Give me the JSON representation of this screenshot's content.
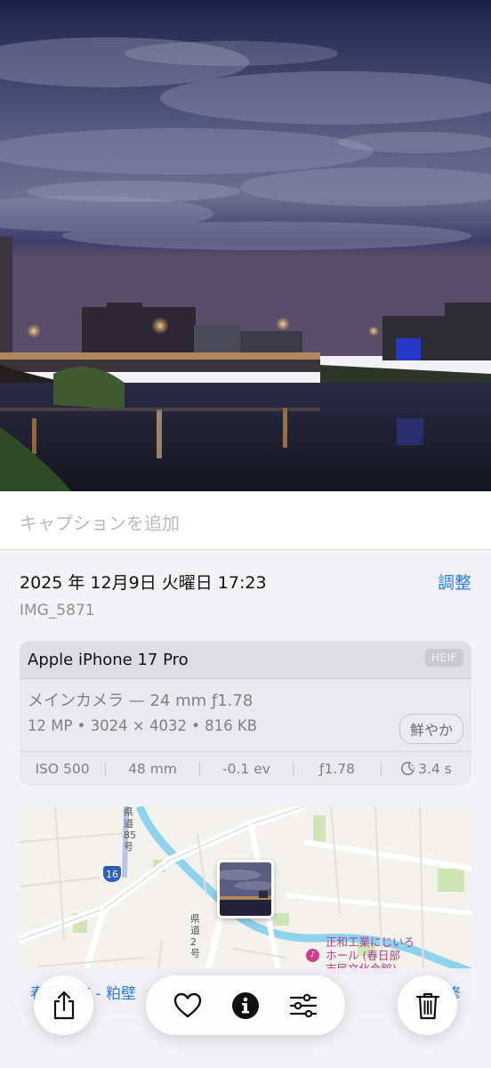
{
  "caption": {
    "placeholder": "キャプションを追加"
  },
  "info": {
    "datetime": "2025 年 12月9日 火曜日 17:23",
    "adjust_label": "調整",
    "filename": "IMG_5871"
  },
  "camera": {
    "device": "Apple iPhone 17 Pro",
    "format_badge": "HEIF",
    "lens": "メインカメラ — 24 mm ƒ1.78",
    "specs": "12 MP • 3024 × 4032 • 816 KB",
    "style": "鮮やか",
    "exif": {
      "iso": "ISO 500",
      "focal": "48 mm",
      "ev": "-0.1 ev",
      "aperture": "ƒ1.78",
      "shutter": "3.4 s"
    }
  },
  "map": {
    "location_left": "春日部市 - 粕壁",
    "location_right": "修",
    "poi_label_line1": "正和工業にじいろ",
    "poi_label_line2": "ホール (春日部",
    "poi_label_line3": "市民文化会館)",
    "route_number": "16",
    "road_label_1": "県道85号",
    "road_label_2": "県道2号"
  },
  "toolbar": {
    "share_icon": "share-icon",
    "favorite_icon": "heart-icon",
    "info_icon": "info-icon",
    "edit_icon": "sliders-icon",
    "delete_icon": "trash-icon"
  },
  "colors": {
    "accent": "#2a7ee8",
    "background": "#f2f2f7"
  }
}
